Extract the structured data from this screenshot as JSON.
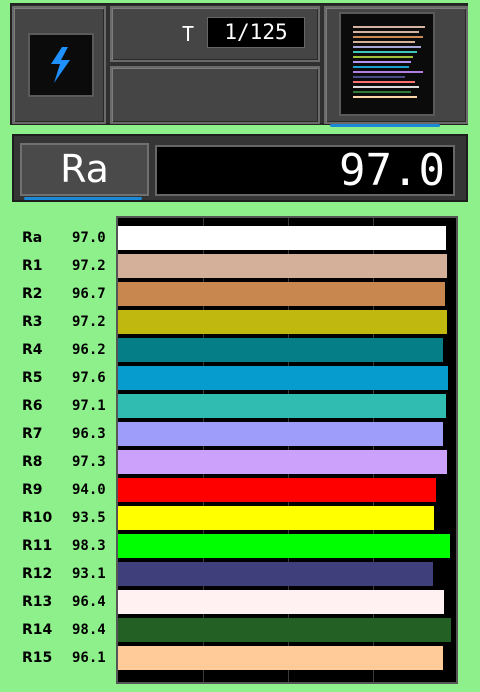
{
  "toolbar": {
    "shutter_label": "T",
    "shutter_value": "1/125"
  },
  "main": {
    "ra_label": "Ra",
    "ra_value": "97.0"
  },
  "chart_data": {
    "type": "bar",
    "orientation": "horizontal",
    "xlim": [
      0,
      100
    ],
    "grid": true,
    "categories": [
      "Ra",
      "R1",
      "R2",
      "R3",
      "R4",
      "R5",
      "R6",
      "R7",
      "R8",
      "R9",
      "R10",
      "R11",
      "R12",
      "R13",
      "R14",
      "R15"
    ],
    "values": [
      97.0,
      97.2,
      96.7,
      97.2,
      96.2,
      97.6,
      97.1,
      96.3,
      97.3,
      94.0,
      93.5,
      98.3,
      93.1,
      96.4,
      98.4,
      96.1
    ],
    "value_labels": [
      "97.0",
      "97.2",
      "96.7",
      "97.2",
      "96.2",
      "97.6",
      "97.1",
      "96.3",
      "97.3",
      "94.0",
      "93.5",
      "98.3",
      "93.1",
      "96.4",
      "98.4",
      "96.1"
    ],
    "colors": [
      "#ffffff",
      "#d4b09a",
      "#c8874f",
      "#c0b70f",
      "#067e88",
      "#069ccd",
      "#30bcb0",
      "#9e9df9",
      "#cca1fb",
      "#ff0000",
      "#ffff00",
      "#00ff00",
      "#3f3f7c",
      "#fff0f2",
      "#226024",
      "#ffcc99"
    ]
  }
}
